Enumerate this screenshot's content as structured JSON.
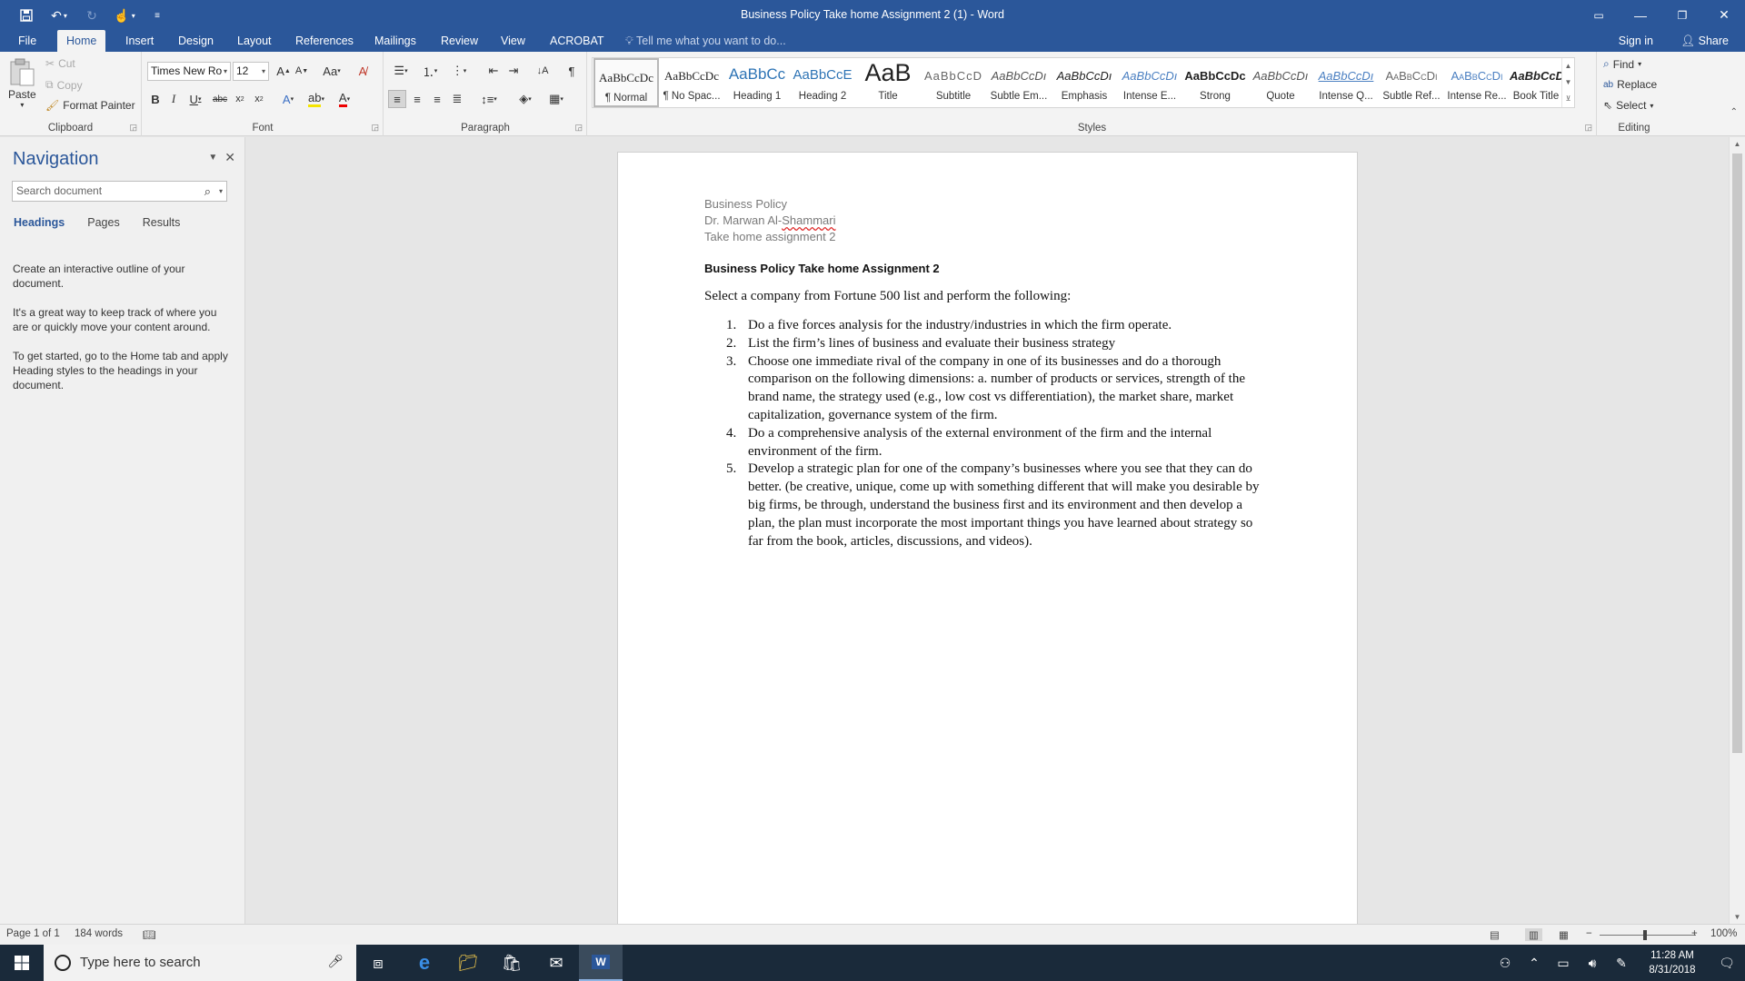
{
  "window": {
    "title": "Business Policy Take home Assignment 2 (1) - Word"
  },
  "tabs": [
    "File",
    "Home",
    "Insert",
    "Design",
    "Layout",
    "References",
    "Mailings",
    "Review",
    "View",
    "ACROBAT"
  ],
  "tell_me": "Tell me what you want to do...",
  "sign_in": "Sign in",
  "share": "Share",
  "clipboard": {
    "paste": "Paste",
    "cut": "Cut",
    "copy": "Copy",
    "format_painter": "Format Painter",
    "label": "Clipboard"
  },
  "font": {
    "name": "Times New Ro",
    "size": "12",
    "label": "Font"
  },
  "paragraph": {
    "label": "Paragraph"
  },
  "styles": {
    "label": "Styles",
    "items": [
      {
        "sample": "AaBbCcDc",
        "name": "¶ Normal"
      },
      {
        "sample": "AaBbCcDc",
        "name": "¶ No Spac..."
      },
      {
        "sample": "AaBbCc",
        "name": "Heading 1"
      },
      {
        "sample": "AaBbCcE",
        "name": "Heading 2"
      },
      {
        "sample": "AaB",
        "name": "Title"
      },
      {
        "sample": "AaBbCcD",
        "name": "Subtitle"
      },
      {
        "sample": "AaBbCcDı",
        "name": "Subtle Em..."
      },
      {
        "sample": "AaBbCcDı",
        "name": "Emphasis"
      },
      {
        "sample": "AaBbCcDı",
        "name": "Intense E..."
      },
      {
        "sample": "AaBbCcDc",
        "name": "Strong"
      },
      {
        "sample": "AaBbCcDı",
        "name": "Quote"
      },
      {
        "sample": "AaBbCcDı",
        "name": "Intense Q..."
      },
      {
        "sample": "AaBbCcDı",
        "name": "Subtle Ref..."
      },
      {
        "sample": "AaBbCcDı",
        "name": "Intense Re..."
      },
      {
        "sample": "AaBbCcDı",
        "name": "Book Title"
      }
    ]
  },
  "editing": {
    "find": "Find",
    "replace": "Replace",
    "select": "Select",
    "label": "Editing"
  },
  "navigation": {
    "title": "Navigation",
    "search_placeholder": "Search document",
    "tabs": [
      "Headings",
      "Pages",
      "Results"
    ],
    "help": [
      "Create an interactive outline of your document.",
      "It's a great way to keep track of where you are or quickly move your content around.",
      "To get started, go to the Home tab and apply Heading styles to the headings in your document."
    ]
  },
  "document": {
    "header_lines": [
      "Business Policy",
      "Take home assignment 2"
    ],
    "author_prefix": "Dr. Marwan Al-",
    "author_misspelled": "Shammari",
    "heading": "Business Policy Take home Assignment 2",
    "intro": "Select a company from Fortune 500 list and perform the following:",
    "list": [
      {
        "num": "1.",
        "text": "Do a five forces analysis for the industry/industries in which the firm operate."
      },
      {
        "num": "2.",
        "text": "List the firm’s lines of business and evaluate their business strategy"
      },
      {
        "num": "3.",
        "text": "Choose one immediate rival of the company in one of its businesses and do a thorough comparison on the following dimensions: a. number of products or services, strength of the brand name, the strategy used (e.g., low cost vs differentiation), the market share, market capitalization, governance system of the firm."
      },
      {
        "num": "4.",
        "text": "Do a comprehensive analysis of the external environment of the firm and the internal environment of the firm."
      },
      {
        "num": "5.",
        "text": "Develop a strategic plan for one of the company’s businesses where you see that they can do better. (be creative, unique, come up with something different that will make you desirable by big firms, be through, understand the business first and its environment and then develop a plan, the plan must incorporate the most important things you have learned about strategy so far from the book, articles, discussions, and videos)."
      }
    ]
  },
  "status": {
    "page": "Page 1 of 1",
    "words": "184 words",
    "zoom": "100%"
  },
  "taskbar": {
    "search_placeholder": "Type here to search",
    "time": "11:28 AM",
    "date": "8/31/2018"
  }
}
